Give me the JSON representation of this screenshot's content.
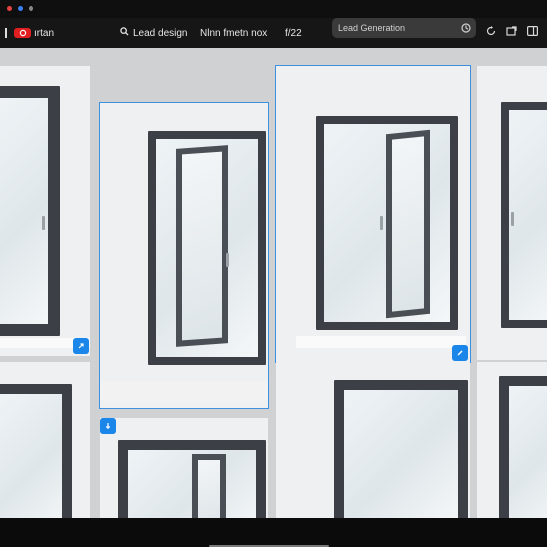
{
  "window": {
    "colors": {
      "close": "#e54242",
      "minimize": "#3b82f6",
      "maximize": "#888888"
    }
  },
  "toolbar": {
    "app_label": "ırtan",
    "nav_items": [
      {
        "label": "Lead design",
        "icon": "search-icon"
      },
      {
        "label": "Nlnn fmetn nox"
      },
      {
        "label": "f/22"
      }
    ],
    "search": {
      "value": "Lead Generation",
      "icon": "clock-icon"
    },
    "icons": [
      "refresh-icon",
      "export-icon",
      "panel-icon"
    ]
  },
  "gallery": {
    "tiles": [
      {
        "name": "window-tile-1",
        "selected": false,
        "badge_icon": "link-icon"
      },
      {
        "name": "window-tile-2",
        "selected": true,
        "badge_icon": "link-icon"
      },
      {
        "name": "window-tile-3",
        "selected": true,
        "badge_icon": "edit-icon"
      },
      {
        "name": "window-tile-4",
        "selected": false,
        "badge_icon": "expand-icon"
      },
      {
        "name": "window-tile-5",
        "selected": false
      },
      {
        "name": "window-tile-6",
        "selected": false,
        "badge_icon": "pin-icon"
      },
      {
        "name": "window-tile-7",
        "selected": false
      },
      {
        "name": "window-tile-8",
        "selected": false
      }
    ]
  },
  "colors": {
    "accent": "#1a86ea",
    "frame": "#3c4046",
    "toolbar_bg": "#161616"
  }
}
